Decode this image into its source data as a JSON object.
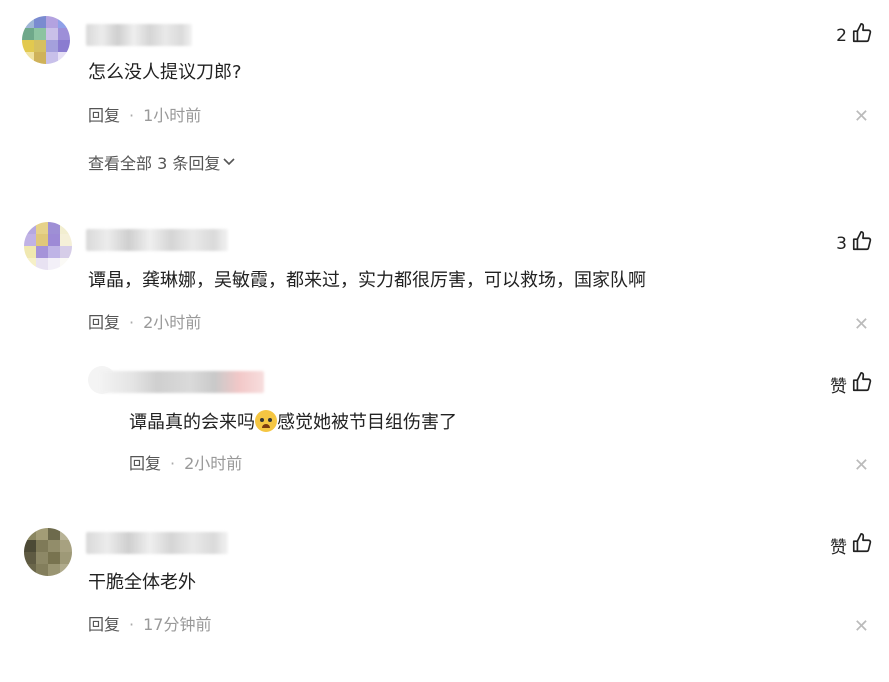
{
  "comments": [
    {
      "text": "怎么没人提议刀郎?",
      "reply_label": "回复",
      "time": "1小时前",
      "likes": "2",
      "expand_label": "查看全部 3 条回复"
    },
    {
      "text": "谭晶，龚琳娜，吴敏霞，都来过，实力都很厉害，可以救场，国家队啊",
      "reply_label": "回复",
      "time": "2小时前",
      "likes": "3",
      "reply": {
        "text_before": "谭晶真的会来吗",
        "emoji": "crying-face-emoji",
        "text_after": "感觉她被节目组伤害了",
        "reply_label": "回复",
        "time": "2小时前",
        "likes": "赞"
      }
    },
    {
      "text": "干脆全体老外",
      "reply_label": "回复",
      "time": "17分钟前",
      "likes": "赞"
    }
  ],
  "icons": {
    "like": "thumbs-up-icon",
    "close": "close-icon",
    "chevron": "chevron-down-icon"
  },
  "colors": {
    "text": "#222222",
    "meta": "#999999",
    "close": "#bbbbbb"
  }
}
